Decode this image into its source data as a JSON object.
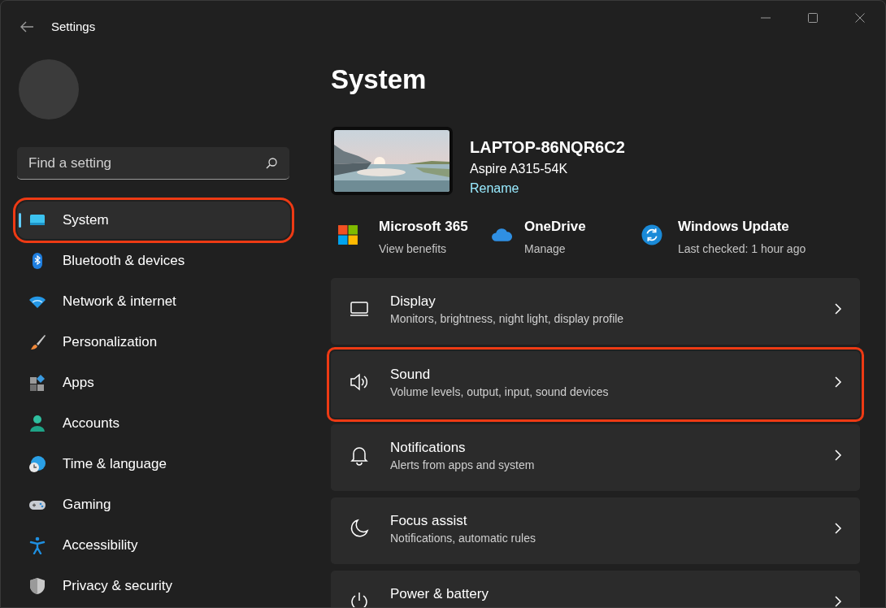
{
  "window": {
    "title": "Settings"
  },
  "sidebar": {
    "search": {
      "placeholder": "Find a setting"
    },
    "items": [
      {
        "label": "System",
        "selected": true,
        "annotated": true
      },
      {
        "label": "Bluetooth & devices",
        "selected": false,
        "annotated": false
      },
      {
        "label": "Network & internet",
        "selected": false,
        "annotated": false
      },
      {
        "label": "Personalization",
        "selected": false,
        "annotated": false
      },
      {
        "label": "Apps",
        "selected": false,
        "annotated": false
      },
      {
        "label": "Accounts",
        "selected": false,
        "annotated": false
      },
      {
        "label": "Time & language",
        "selected": false,
        "annotated": false
      },
      {
        "label": "Gaming",
        "selected": false,
        "annotated": false
      },
      {
        "label": "Accessibility",
        "selected": false,
        "annotated": false
      },
      {
        "label": "Privacy & security",
        "selected": false,
        "annotated": false
      }
    ]
  },
  "page": {
    "title": "System",
    "device": {
      "name": "LAPTOP-86NQR6C2",
      "model": "Aspire A315-54K",
      "link": "Rename"
    },
    "quick_links": [
      {
        "title": "Microsoft 365",
        "subtitle": "View benefits"
      },
      {
        "title": "OneDrive",
        "subtitle": "Manage"
      },
      {
        "title": "Windows Update",
        "subtitle": "Last checked: 1 hour ago"
      }
    ],
    "cards": [
      {
        "title": "Display",
        "subtitle": "Monitors, brightness, night light, display profile",
        "annotated": false
      },
      {
        "title": "Sound",
        "subtitle": "Volume levels, output, input, sound devices",
        "annotated": true
      },
      {
        "title": "Notifications",
        "subtitle": "Alerts from apps and system",
        "annotated": false
      },
      {
        "title": "Focus assist",
        "subtitle": "Notifications, automatic rules",
        "annotated": false
      },
      {
        "title": "Power & battery",
        "annotated": false
      }
    ]
  }
}
